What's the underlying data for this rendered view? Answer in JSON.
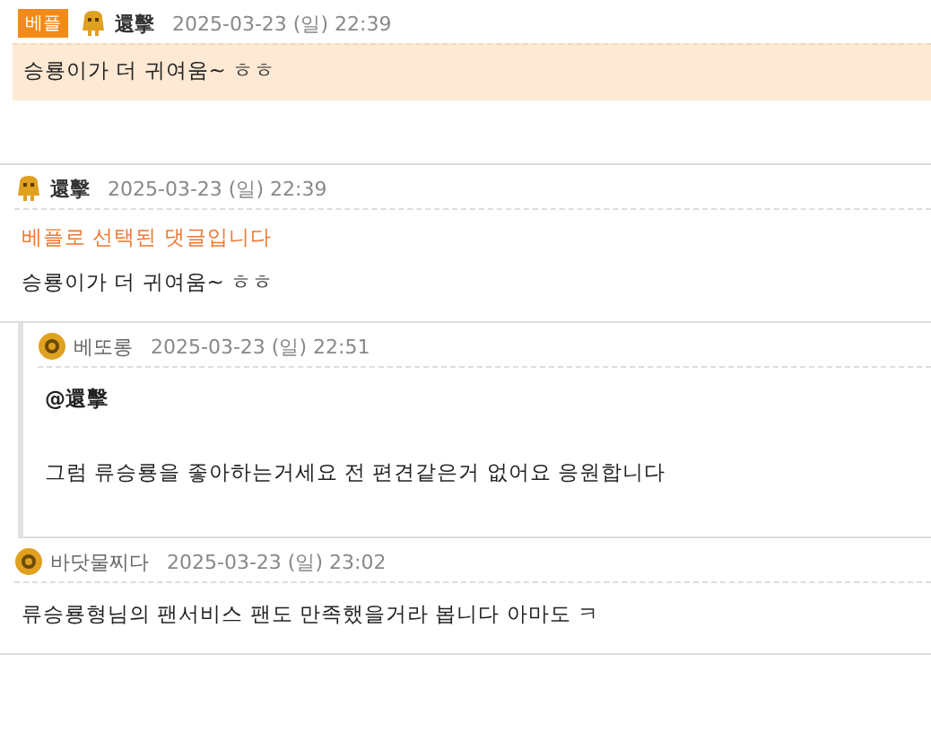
{
  "comments": [
    {
      "kind": "best",
      "badge": "베플",
      "avatar": {
        "kind": "mascot"
      },
      "author": "還擊",
      "date": "2025-03-23 (일) 22:39",
      "body": "승룡이가 더 귀여움~ ㅎㅎ"
    },
    {
      "kind": "normal",
      "avatar": {
        "kind": "mascot"
      },
      "author": "還擊",
      "date": "2025-03-23 (일) 22:39",
      "notice": "베플로 선택된 댓글입니다",
      "body": "승룡이가 더 귀여움~ ㅎㅎ"
    },
    {
      "kind": "reply",
      "avatar": {
        "kind": "medal"
      },
      "author": "베또롱",
      "date": "2025-03-23 (일) 22:51",
      "mention": "@還擊",
      "body": "그럼 류승룡을 좋아하는거세요 전 편견같은거 없어요 응원합니다"
    },
    {
      "kind": "normal",
      "avatar": {
        "kind": "medal"
      },
      "author": "바닷물찌다",
      "date": "2025-03-23 (일) 23:02",
      "body": "류승룡형님의 팬서비스 팬도 만족했을거라 봅니다 아마도 ㅋ"
    }
  ]
}
